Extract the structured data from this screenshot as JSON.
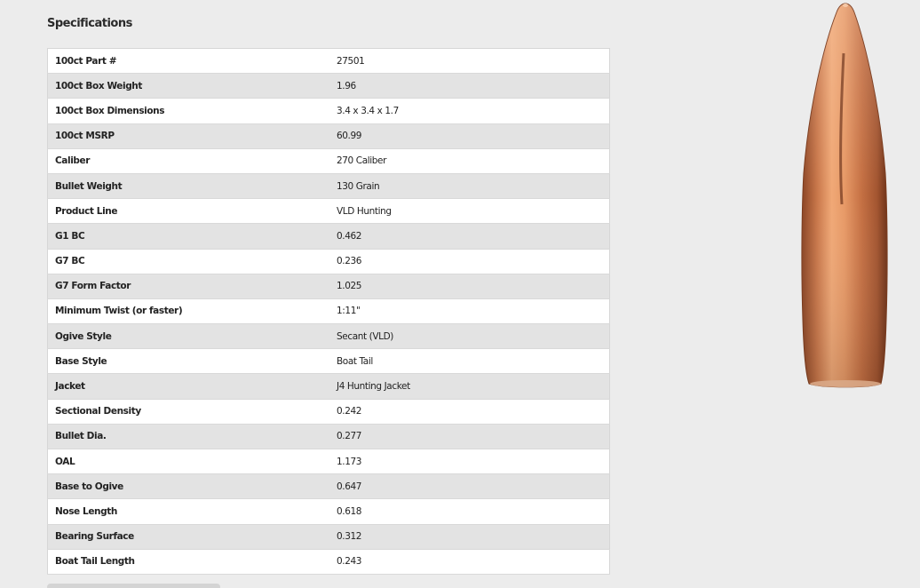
{
  "section": {
    "title": "Specifications"
  },
  "specs": [
    {
      "label": "100ct Part #",
      "value": "27501"
    },
    {
      "label": "100ct Box Weight",
      "value": "1.96"
    },
    {
      "label": "100ct Box Dimensions",
      "value": "3.4 x 3.4 x 1.7"
    },
    {
      "label": "100ct MSRP",
      "value": "60.99"
    },
    {
      "label": "Caliber",
      "value": "270 Caliber"
    },
    {
      "label": "Bullet Weight",
      "value": "130 Grain"
    },
    {
      "label": "Product Line",
      "value": "VLD Hunting"
    },
    {
      "label": "G1 BC",
      "value": "0.462"
    },
    {
      "label": "G7 BC",
      "value": "0.236"
    },
    {
      "label": "G7 Form Factor",
      "value": "1.025"
    },
    {
      "label": "Minimum Twist (or faster)",
      "value": "1:11\""
    },
    {
      "label": "Ogive Style",
      "value": "Secant (VLD)"
    },
    {
      "label": "Base Style",
      "value": "Boat Tail"
    },
    {
      "label": "Jacket",
      "value": "J4 Hunting Jacket"
    },
    {
      "label": "Sectional Density",
      "value": "0.242"
    },
    {
      "label": "Bullet Dia.",
      "value": "0.277"
    },
    {
      "label": "OAL",
      "value": "1.173"
    },
    {
      "label": "Base to Ogive",
      "value": "0.647"
    },
    {
      "label": "Nose Length",
      "value": "0.618"
    },
    {
      "label": "Bearing Surface",
      "value": "0.312"
    },
    {
      "label": "Boat Tail Length",
      "value": "0.243"
    }
  ],
  "product_image": {
    "icon": "bullet-image",
    "colors": {
      "copper_light": "#f0a876",
      "copper_mid": "#c9774a",
      "copper_dark": "#8a4424"
    }
  }
}
